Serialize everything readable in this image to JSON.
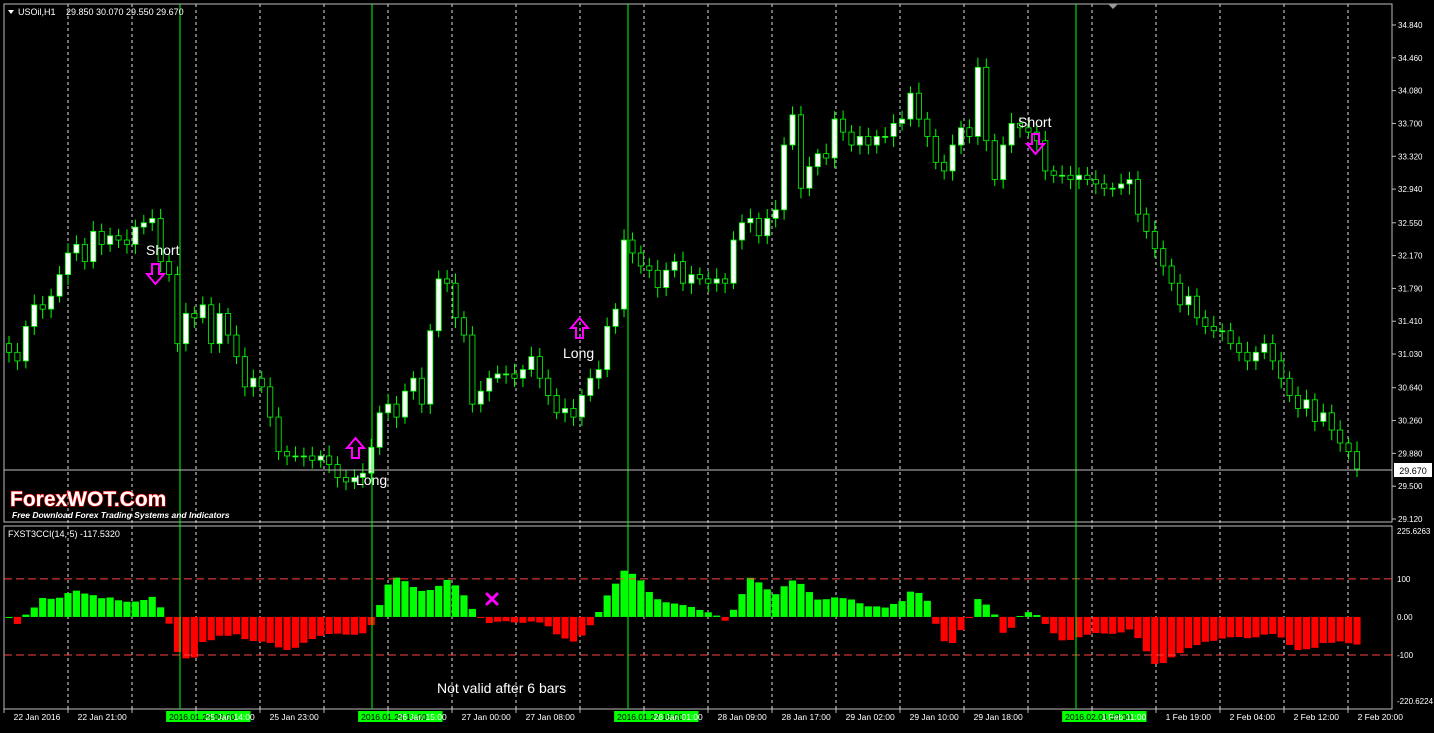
{
  "header": {
    "symbol": "USOil,H1",
    "ohlc": "29.850 30.070 29.550 29.670",
    "dropdown_icon": "triangle-down-icon"
  },
  "indicator": {
    "label": "FXST3CCI(14, 5) -117.5320",
    "levels": [
      100,
      -100
    ],
    "level_labels": [
      "225.6263",
      "100",
      "0.00",
      "-100",
      "-220.6224"
    ]
  },
  "watermark": {
    "brand": "ForexWOT.Com",
    "tagline": "Free Download Forex Trading Systems and Indicators"
  },
  "annotations": {
    "short": "Short",
    "long": "Long",
    "not_valid": "Not valid after 6 bars"
  },
  "colors": {
    "background": "#000000",
    "bull_body": "#ffffff",
    "bear_body": "#000000",
    "candle_outline": "#00ff00",
    "osc_positive": "#00ff00",
    "osc_negative": "#ff0000",
    "signal_line": "#00ff00",
    "arrow": "#ff00ff",
    "level_line": "#ff4040",
    "current_price_line": "#c0c0c0",
    "time_highlight": "#00ff00"
  },
  "chart_data": {
    "type": "candlestick",
    "current_price": 29.67,
    "price_range": [
      29.12,
      35.0
    ],
    "price_ticks": [
      "34.840",
      "34.460",
      "34.080",
      "33.700",
      "33.320",
      "32.940",
      "32.550",
      "32.170",
      "31.790",
      "31.410",
      "31.030",
      "30.640",
      "30.260",
      "29.880",
      "29.500",
      "29.120"
    ],
    "current_price_label": "29.670",
    "time_labels": [
      "22 Jan 2016",
      "22 Jan 21:00",
      "2016.01.25 09:00",
      "25 Jan 14:00",
      "25 Jan 23:00",
      "2016.01.26 11:00",
      "26 Jan 15:00",
      "27 Jan 00:00",
      "27 Jan 08:00",
      "2016.01.27 16:00",
      "28 Jan 01:00",
      "28 Jan 09:00",
      "28 Jan 17:00",
      "29 Jan 02:00",
      "29 Jan 10:00",
      "29 Jan 18:00",
      "2016.02.01 03:00",
      "1 Feb 11:00",
      "1 Feb 19:00",
      "2 Feb 04:00",
      "2 Feb 12:00",
      "2 Feb 20:00"
    ],
    "highlighted_time_labels": [
      "2016.01.25 09:00",
      "2016.01.26 11:00",
      "2016.01.27 16:00",
      "2016.02.01 03:00"
    ],
    "closes": [
      31.05,
      30.95,
      31.35,
      31.6,
      31.55,
      31.7,
      31.95,
      32.2,
      32.3,
      32.1,
      32.45,
      32.3,
      32.4,
      32.35,
      32.3,
      32.5,
      32.55,
      32.6,
      32.1,
      31.95,
      31.15,
      31.5,
      31.45,
      31.6,
      31.15,
      31.5,
      31.25,
      31.0,
      30.65,
      30.75,
      30.65,
      30.3,
      29.9,
      29.85,
      29.85,
      29.85,
      29.8,
      29.85,
      29.75,
      29.6,
      29.55,
      29.6,
      29.65,
      29.95,
      30.35,
      30.45,
      30.3,
      30.6,
      30.75,
      30.45,
      31.3,
      31.9,
      31.85,
      31.45,
      31.25,
      30.45,
      30.6,
      30.75,
      30.8,
      30.8,
      30.75,
      30.85,
      31.0,
      30.75,
      30.55,
      30.35,
      30.4,
      30.3,
      30.55,
      30.75,
      30.85,
      31.35,
      31.55,
      32.35,
      32.2,
      32.05,
      32.0,
      31.8,
      32.0,
      32.1,
      31.85,
      31.95,
      31.9,
      31.85,
      31.9,
      31.85,
      32.35,
      32.55,
      32.6,
      32.4,
      32.6,
      32.7,
      33.45,
      33.8,
      32.95,
      33.2,
      33.35,
      33.3,
      33.75,
      33.6,
      33.45,
      33.55,
      33.45,
      33.55,
      33.55,
      33.7,
      33.75,
      34.05,
      33.75,
      33.55,
      33.25,
      33.15,
      33.45,
      33.65,
      33.55,
      34.35,
      33.5,
      33.05,
      33.45,
      33.7,
      33.65,
      33.6,
      33.5,
      33.15,
      33.1,
      33.1,
      33.05,
      33.1,
      33.05,
      33.0,
      32.95,
      32.95,
      33.0,
      33.05,
      32.65,
      32.45,
      32.25,
      32.05,
      31.85,
      31.6,
      31.7,
      31.45,
      31.35,
      31.3,
      31.3,
      31.15,
      31.05,
      30.95,
      31.05,
      31.15,
      30.95,
      30.75,
      30.55,
      30.4,
      30.5,
      30.25,
      30.35,
      30.15,
      30.0,
      29.9,
      29.7
    ]
  }
}
